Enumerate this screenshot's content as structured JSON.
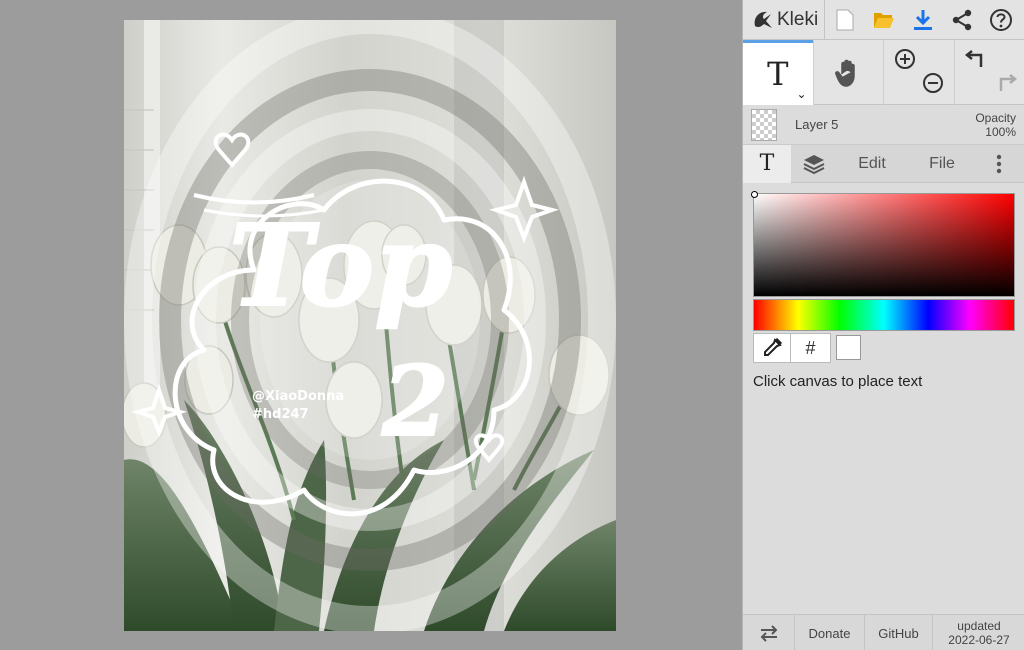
{
  "app": {
    "name": "Kleki"
  },
  "toolbar": {
    "icons": [
      "new-file-icon",
      "open-folder-icon",
      "download-icon",
      "share-icon",
      "help-icon"
    ]
  },
  "tools": {
    "active_tool_glyph": "T",
    "active_tool_caret": "⌄",
    "hand_tool_icon": "hand-icon",
    "zoom_icons": [
      "zoom-in-icon",
      "zoom-out-icon"
    ],
    "history_icons": [
      "undo-icon",
      "redo-icon"
    ]
  },
  "layer": {
    "name": "Layer 5",
    "opacity_label": "Opacity",
    "opacity_value": "100%"
  },
  "tabs": {
    "text_tab_glyph": "T",
    "layers_tab_icon": "layers-icon",
    "edit": "Edit",
    "file": "File",
    "more_icon": "more-vertical-icon"
  },
  "color": {
    "hex_symbol": "#",
    "current": "#ffffff",
    "accent": "#5aa0e6"
  },
  "hint": "Click canvas to place text",
  "footer": {
    "swap_icon": "swap-icon",
    "donate": "Donate",
    "github": "GitHub",
    "updated_label": "updated",
    "updated_date": "2022-06-27"
  },
  "artwork": {
    "title_text": "Top",
    "number_text": "2",
    "handle": "@XiaoDonna",
    "tag": "#hd247"
  }
}
